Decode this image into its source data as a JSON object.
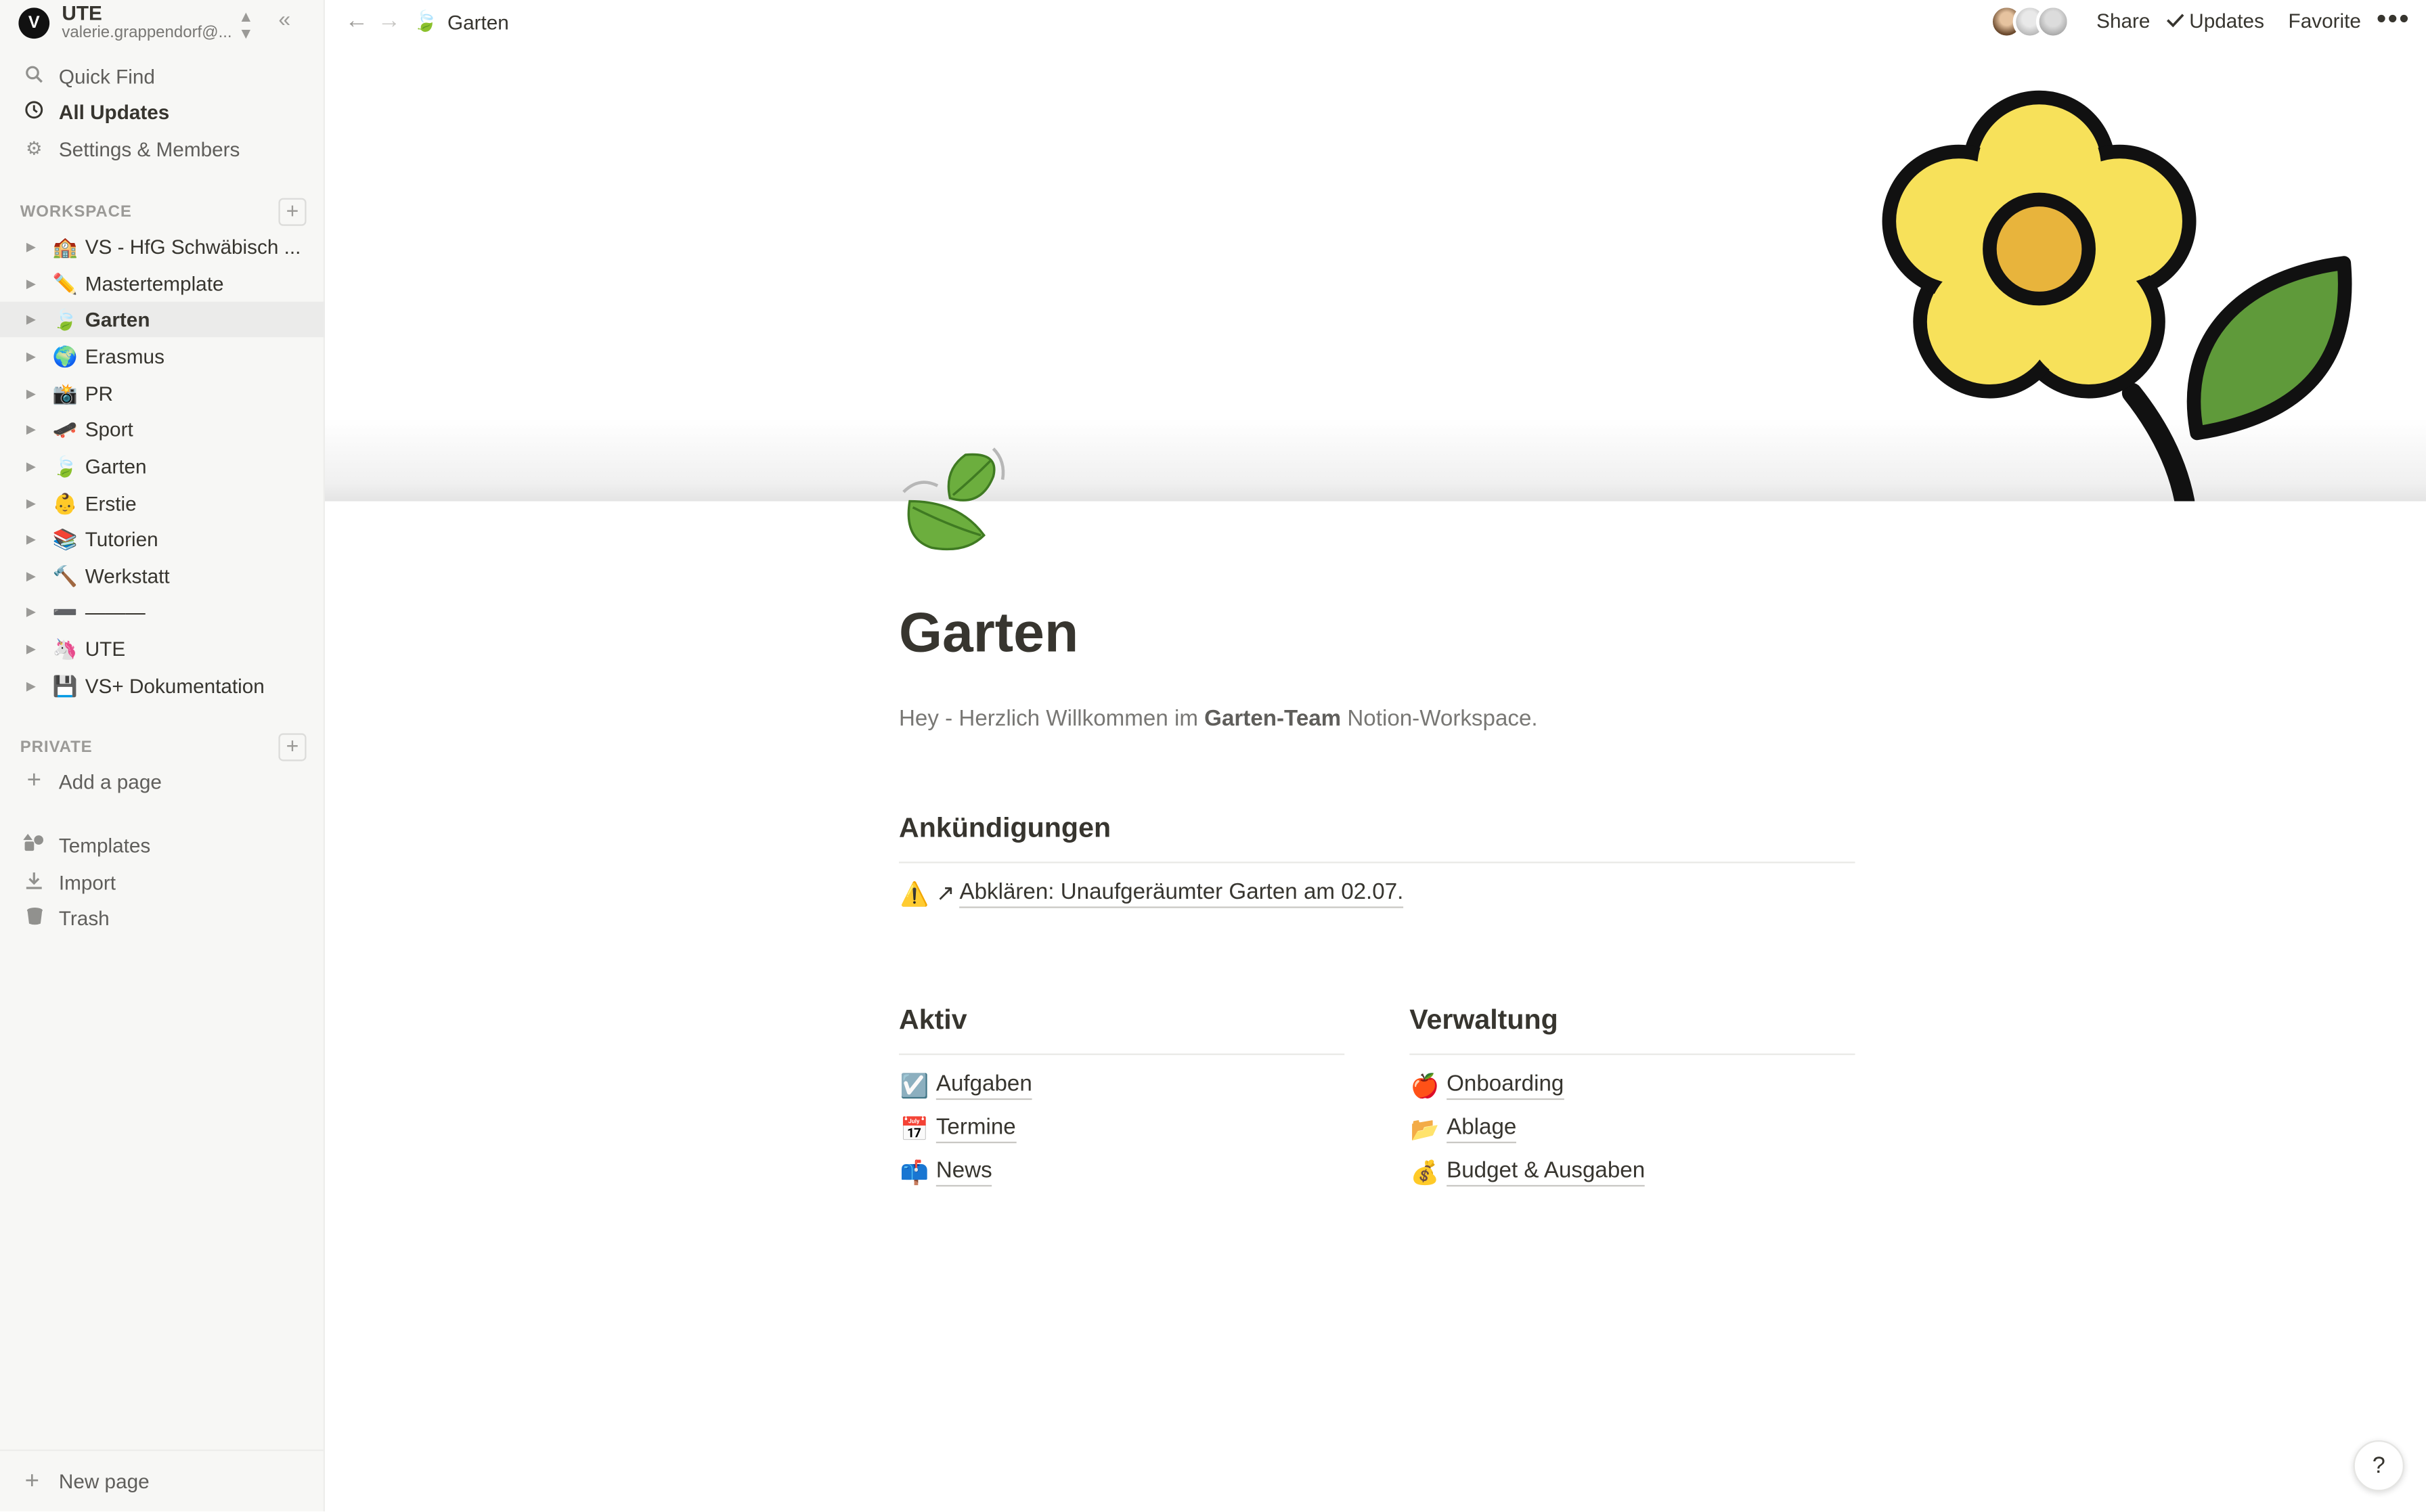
{
  "workspace": {
    "name": "UTE",
    "email": "valerie.grappendorf@...",
    "logo_letter": "V"
  },
  "nav": [
    {
      "label": "Quick Find",
      "icon": "search-icon"
    },
    {
      "label": "All Updates",
      "icon": "clock-icon"
    },
    {
      "label": "Settings & Members",
      "icon": "gear-icon"
    }
  ],
  "sections": {
    "workspace": "WORKSPACE",
    "private": "PRIVATE"
  },
  "tree": [
    {
      "emoji": "🏫",
      "label": "VS - HfG Schwäbisch ..."
    },
    {
      "emoji": "✏️",
      "label": "Mastertemplate"
    },
    {
      "emoji": "🍃",
      "label": "Garten"
    },
    {
      "emoji": "🌍",
      "label": "Erasmus"
    },
    {
      "emoji": "📸",
      "label": "PR"
    },
    {
      "emoji": "🛹",
      "label": "Sport"
    },
    {
      "emoji": "🍃",
      "label": "Garten"
    },
    {
      "emoji": "👶",
      "label": "Erstie"
    },
    {
      "emoji": "📚",
      "label": "Tutorien"
    },
    {
      "emoji": "🔨",
      "label": "Werkstatt"
    },
    {
      "emoji": "➖",
      "label": "———"
    },
    {
      "emoji": "🦄",
      "label": "UTE"
    },
    {
      "emoji": "💾",
      "label": "VS+ Dokumentation"
    }
  ],
  "private_add": "Add a page",
  "bottom_nav": [
    {
      "label": "Templates",
      "icon": "templates-icon"
    },
    {
      "label": "Import",
      "icon": "import-icon"
    },
    {
      "label": "Trash",
      "icon": "trash-icon"
    }
  ],
  "new_page": "New page",
  "topbar": {
    "breadcrumb": "Garten",
    "breadcrumb_emoji": "🍃",
    "share": "Share",
    "updates": "Updates",
    "favorite": "Favorite",
    "more": "•••"
  },
  "page": {
    "icon_emoji": "🍃",
    "title": "Garten",
    "intro_prefix": "Hey - Herzlich Willkommen im ",
    "intro_bold": "Garten-Team",
    "intro_suffix": " Notion-Workspace.",
    "announcements_heading": "Ankündigungen",
    "announcement": {
      "emoji": "⚠️",
      "arrow": "↗",
      "text": "Abklären: Unaufgeräumter Garten am 02.07."
    },
    "aktiv_heading": "Aktiv",
    "aktiv_links": [
      {
        "emoji": "☑️",
        "label": "Aufgaben"
      },
      {
        "emoji": "📅",
        "label": "Termine"
      },
      {
        "emoji": "📫",
        "label": "News"
      }
    ],
    "verwaltung_heading": "Verwaltung",
    "verwaltung_links": [
      {
        "emoji": "🍎",
        "label": "Onboarding"
      },
      {
        "emoji": "📂",
        "label": "Ablage"
      },
      {
        "emoji": "💰",
        "label": "Budget & Ausgaben"
      }
    ]
  },
  "help": "?",
  "colors": {
    "sidebar_bg": "#f7f7f5",
    "text": "#37352f",
    "flower_yellow": "#f7e15a",
    "flower_center": "#e8b43c",
    "leaf_green": "#5f9a3a"
  }
}
